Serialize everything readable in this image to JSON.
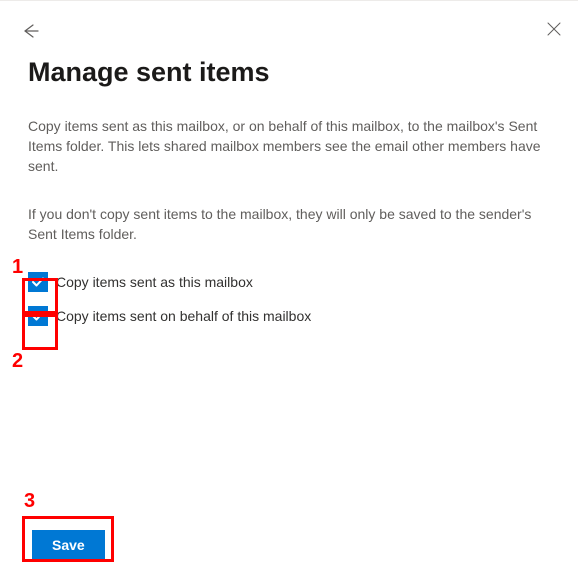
{
  "header": {
    "title": "Manage sent items"
  },
  "description1": "Copy items sent as this mailbox, or on behalf of this mailbox, to the mailbox's Sent Items folder. This lets shared mailbox members see the email other members have sent.",
  "description2": "If you don't copy sent items to the mailbox, they will only be saved to the sender's Sent Items folder.",
  "options": {
    "copy_sent_as": {
      "label": "Copy items sent as this mailbox",
      "checked": true
    },
    "copy_sent_on_behalf": {
      "label": "Copy items sent on behalf of this mailbox",
      "checked": true
    }
  },
  "actions": {
    "save_label": "Save"
  },
  "annotations": {
    "a1": "1",
    "a2": "2",
    "a3": "3"
  }
}
